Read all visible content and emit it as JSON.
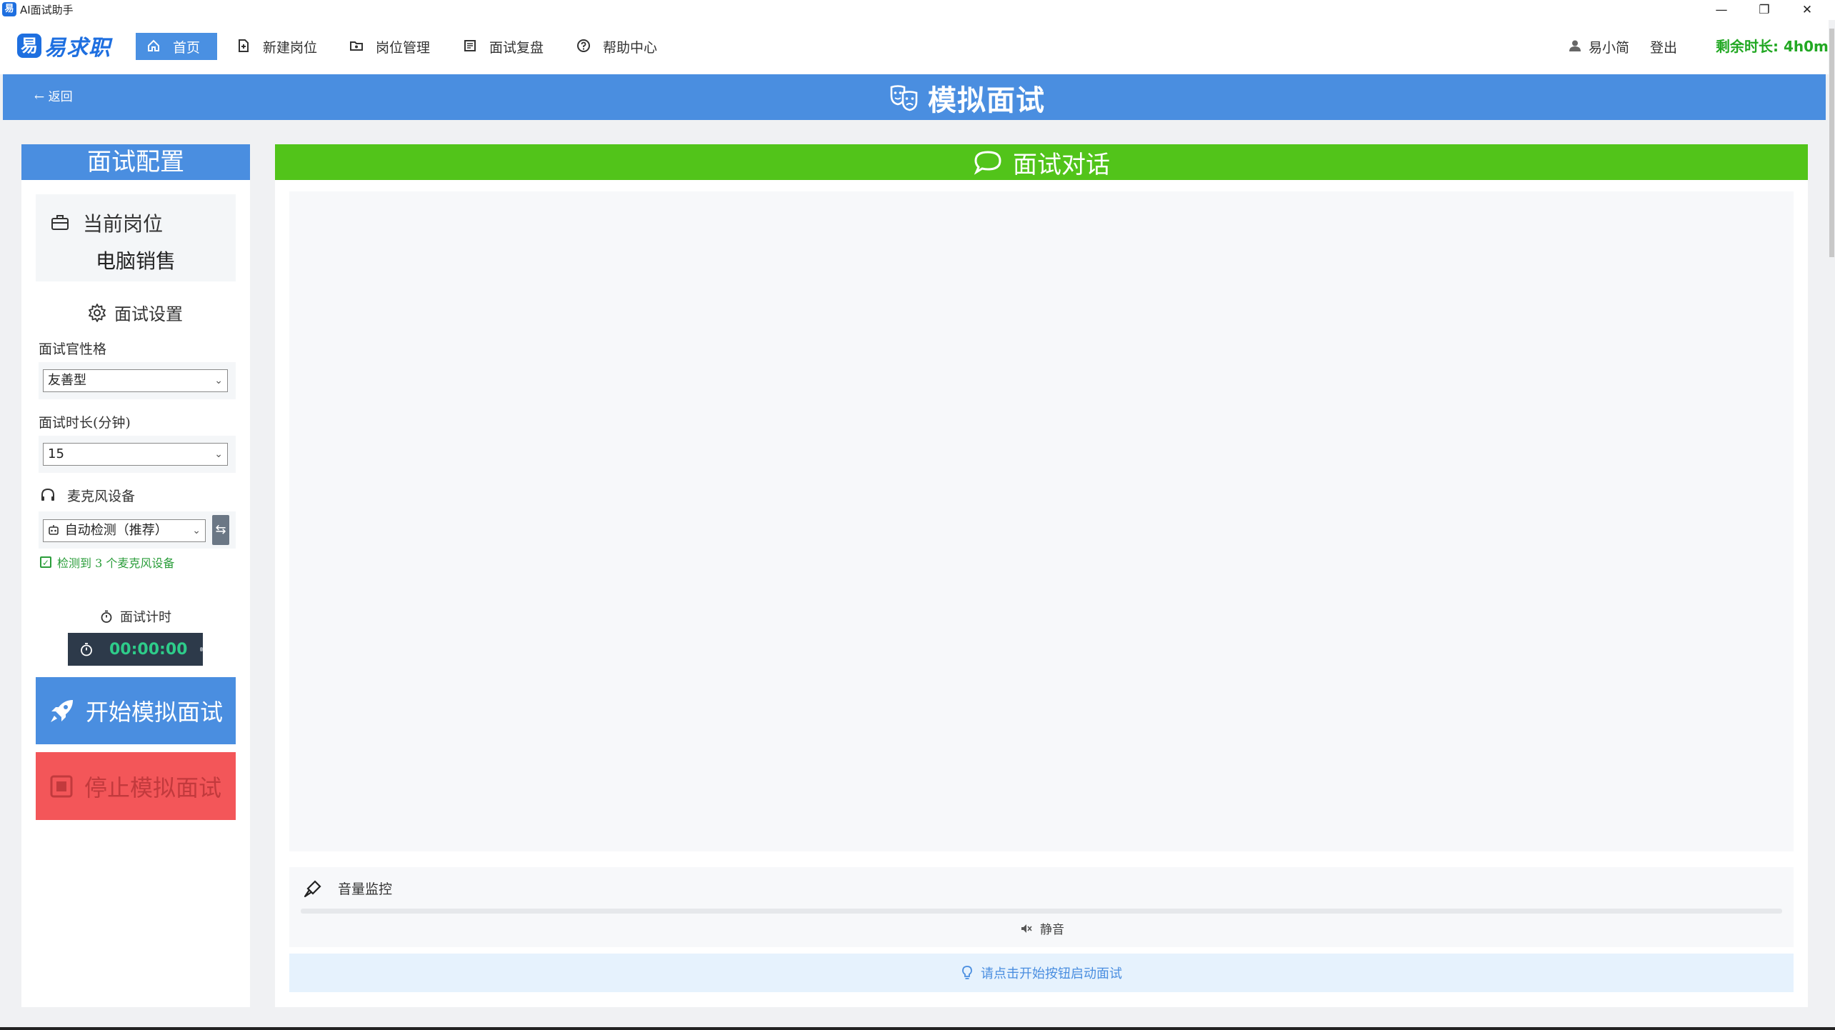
{
  "window": {
    "title": "AI面试助手",
    "app_icon_char": "易",
    "controls": [
      "—",
      "❐",
      "✕"
    ]
  },
  "nav": {
    "logo_text": "易求职",
    "logo_mark": "易",
    "items": [
      {
        "label": "首页",
        "icon": "home-icon",
        "active": true
      },
      {
        "label": "新建岗位",
        "icon": "new-document-icon",
        "active": false
      },
      {
        "label": "岗位管理",
        "icon": "folder-icon",
        "active": false
      },
      {
        "label": "面试复盘",
        "icon": "review-list-icon",
        "active": false
      },
      {
        "label": "帮助中心",
        "icon": "help-icon",
        "active": false
      }
    ],
    "user_name": "易小简",
    "logout_label": "登出",
    "remaining_time": "剩余时长: 4h0m"
  },
  "header": {
    "back_label": "← 返回",
    "title": "模拟面试"
  },
  "config": {
    "title": "面试配置",
    "position_label": "当前岗位",
    "position_value": "电脑销售",
    "settings_title": "面试设置",
    "personality_label": "面试官性格",
    "personality_value": "友善型",
    "duration_label": "面试时长(分钟)",
    "duration_value": "15",
    "mic_label": "麦克风设备",
    "mic_value": "自动检测（推荐）",
    "mic_detected": "检测到 3 个麦克风设备",
    "timer_label": "面试计时",
    "timer_value": "00:00:00",
    "start_label": "开始模拟面试",
    "stop_label": "停止模拟面试"
  },
  "chat": {
    "title": "面试对话",
    "volume_label": "音量监控",
    "volume_level": 0,
    "mute_status": "静音",
    "hint": "请点击开始按钮启动面试"
  },
  "colors": {
    "primary": "#4a8ee0",
    "success_green": "#52c41a",
    "danger_red": "#f35659",
    "remaining_green": "#22a823",
    "timer_bg": "#2d3a4a"
  }
}
